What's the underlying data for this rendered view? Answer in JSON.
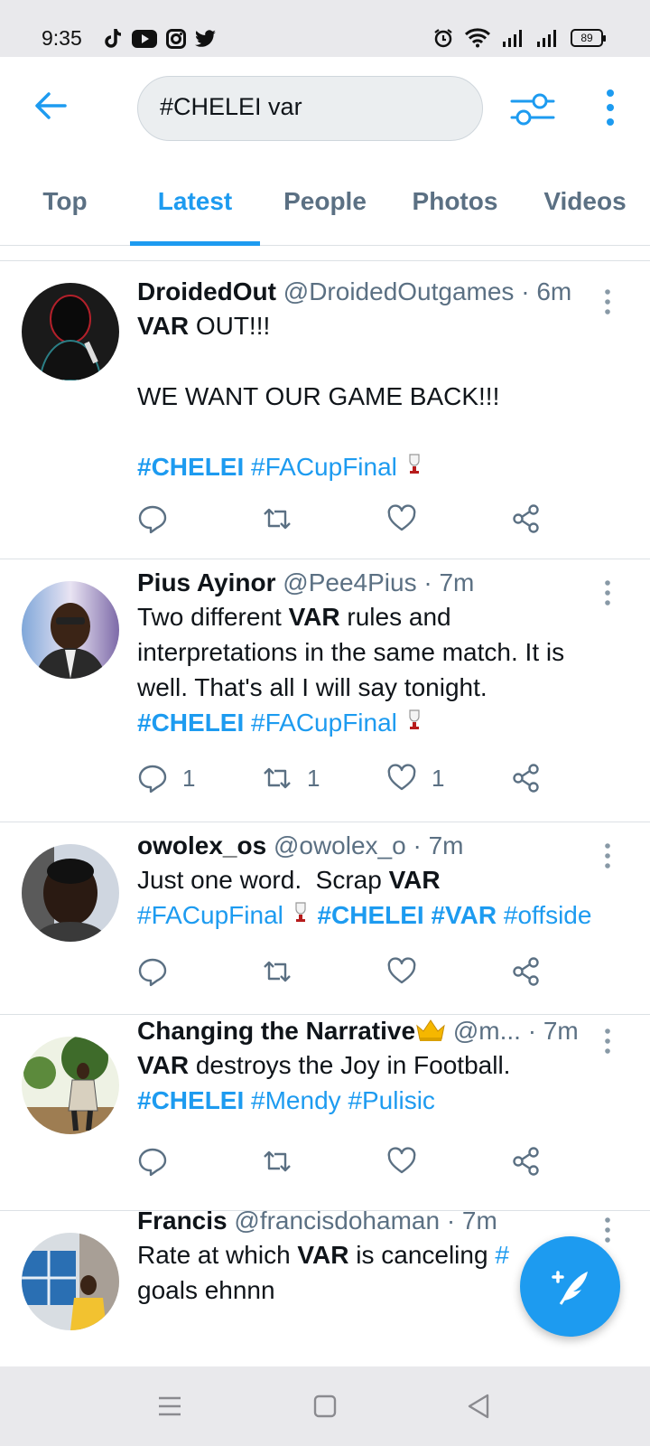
{
  "status_bar": {
    "time": "9:35",
    "left_icons": [
      "tiktok-icon",
      "youtube-icon",
      "instagram-icon",
      "twitter-icon"
    ],
    "right_icons": [
      "alarm-icon",
      "wifi-icon",
      "signal-icon",
      "signal-icon"
    ],
    "battery": "89"
  },
  "header": {
    "search_value": "#CHELEI var"
  },
  "tabs": [
    {
      "label": "Top",
      "active": false
    },
    {
      "label": "Latest",
      "active": true
    },
    {
      "label": "People",
      "active": false
    },
    {
      "label": "Photos",
      "active": false
    },
    {
      "label": "Videos",
      "active": false
    }
  ],
  "tweets": [
    {
      "name": "DroidedOut",
      "handle": "@DroidedOutgames · 6m",
      "line1_bold": "VAR",
      "line1_rest": " OUT!!!",
      "line2": "WE WANT OUR GAME BACK!!!",
      "tag1": "#CHELEI",
      "tag2": "#FACupFinal",
      "replies": "",
      "retweets": "",
      "likes": ""
    },
    {
      "name": "Pius Ayinor",
      "handle": "@Pee4Pius · 7m",
      "text_a": "Two different ",
      "text_bold": "VAR",
      "text_b": " rules and",
      "text_line2": "interpretations in the same match. It is",
      "text_line3": "well. That's all I will say tonight.",
      "tag1": "#CHELEI",
      "tag2": "#FACupFinal",
      "replies": "1",
      "retweets": "1",
      "likes": "1"
    },
    {
      "name": "owolex_os",
      "handle": "@owolex_o · 7m",
      "text_a": "Just one word.  Scrap ",
      "text_bold": "VAR",
      "tag1": "#FACupFinal",
      "tag2": "#CHELEI",
      "tag3": "#VAR",
      "tag4": "#offside",
      "replies": "",
      "retweets": "",
      "likes": ""
    },
    {
      "name": "Changing the Narrative",
      "handle": "@m... · 7m",
      "text_bold": "VAR",
      "text_rest": " destroys the Joy in Football.",
      "tag1": "#CHELEI",
      "tag2": "#Mendy",
      "tag3": "#Pulisic",
      "replies": "",
      "retweets": "",
      "likes": ""
    },
    {
      "name": "Francis",
      "handle": "@francisdohaman · 7m",
      "text_a": "Rate at which ",
      "text_bold": "VAR",
      "text_b": " is canceling ",
      "text_hidden_tag": "#",
      "text_line2": "goals ehnnn"
    }
  ],
  "colors": {
    "accent": "#1d9bf0",
    "secondary_text": "#5b7083",
    "divider": "#dce1e5"
  }
}
